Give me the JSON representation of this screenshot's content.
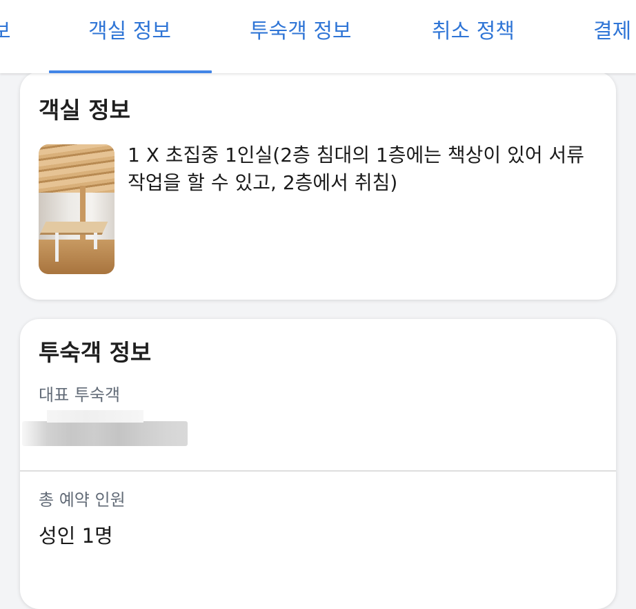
{
  "tabs": [
    {
      "label": "보"
    },
    {
      "label": "객실 정보",
      "active": true
    },
    {
      "label": "투숙객 정보"
    },
    {
      "label": "취소 정책"
    },
    {
      "label": "결제"
    }
  ],
  "colors": {
    "accent": "#2f75d6",
    "indicator": "#4285e6",
    "page_background": "#f3f4f6",
    "card_background": "#ffffff",
    "label_gray": "#626b77"
  },
  "room_info": {
    "title": "객실 정보",
    "image_alt": "room-photo",
    "description": "1 X 초집중 1인실(2층 침대의 1층에는 책상이 있어 서류작업을 할 수 있고, 2층에서 취침)"
  },
  "guest_info": {
    "title": "투숙객 정보",
    "primary_guest_label": "대표 투숙객",
    "total_guests_label": "총 예약 인원",
    "total_guests_value": "성인 1명"
  }
}
